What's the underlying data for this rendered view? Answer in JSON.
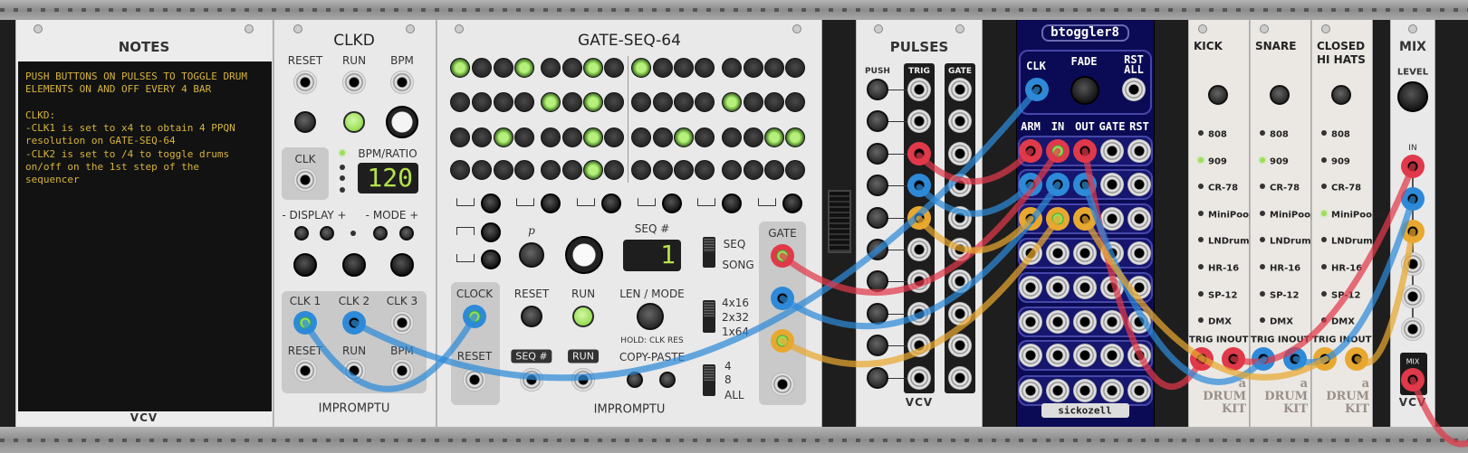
{
  "colors": {
    "cable_red": "#e0394a",
    "cable_blue": "#2e8ad8",
    "cable_yellow": "#e8a830",
    "led_green": "#9be05a",
    "btoggler_panel": "#0b0b55"
  },
  "notes": {
    "title": "NOTES",
    "text": "PUSH BUTTONS ON PULSES TO TOGGLE DRUM\nELEMENTS ON AND OFF EVERY 4 BAR\n\nCLKD:\n-CLK1 is set to x4 to obtain 4 PPQN\nresolution on GATE-SEQ-64\n-CLK2 is set to /4 to toggle drums\non/off on the 1st step of the\nsequencer",
    "brand": "VCV"
  },
  "clkd": {
    "title": "CLKD",
    "reset": "RESET",
    "run": "RUN",
    "bpm": "BPM",
    "clk": "CLK",
    "bpm_ratio": "BPM/RATIO",
    "display_ctl": "- DISPLAY +",
    "mode_ctl": "- MODE +",
    "clk1": "CLK 1",
    "clk2": "CLK 2",
    "clk3": "CLK 3",
    "reset_in": "RESET",
    "run_in": "RUN",
    "bpm_in": "BPM",
    "display": "120",
    "brand": "IMPROMPTU"
  },
  "gate_seq": {
    "title": "GATE-SEQ-64",
    "grid": [
      [
        1,
        0,
        0,
        1,
        0,
        0,
        1,
        0,
        1,
        0,
        0,
        0,
        0,
        0,
        0,
        0
      ],
      [
        0,
        0,
        0,
        0,
        1,
        0,
        1,
        0,
        0,
        0,
        0,
        0,
        1,
        0,
        0,
        0
      ],
      [
        0,
        0,
        1,
        0,
        0,
        0,
        1,
        0,
        0,
        0,
        1,
        0,
        0,
        0,
        1,
        1
      ],
      [
        0,
        0,
        0,
        0,
        0,
        0,
        1,
        0,
        0,
        0,
        0,
        0,
        0,
        0,
        0,
        0
      ]
    ],
    "p": "p",
    "seq_num": "SEQ #",
    "seq_display": "1",
    "seq": "SEQ",
    "song": "SONG",
    "clock": "CLOCK",
    "reset": "RESET",
    "run": "RUN",
    "len_mode": "LEN / MODE",
    "hold": "HOLD: CLK RES",
    "seq_in": "SEQ #",
    "run_in": "RUN",
    "reset_in": "RESET",
    "copy_paste": "COPY-PASTE",
    "len_options": [
      "4x16",
      "2x32",
      "1x64"
    ],
    "copy_options": [
      "4",
      "8",
      "ALL"
    ],
    "gate": "GATE",
    "brand": "IMPROMPTU"
  },
  "pulses": {
    "title": "PULSES",
    "push": "PUSH",
    "trig": "TRIG",
    "gate": "GATE",
    "brand": "VCV"
  },
  "btoggler": {
    "title": "btoggler8",
    "clk": "CLK",
    "fade": "FADE",
    "rst": "RST",
    "all": "ALL",
    "cols": [
      "ARM",
      "IN",
      "OUT",
      "GATE",
      "RST"
    ],
    "brand": "sickozell"
  },
  "drums": {
    "kits": [
      "808",
      "909",
      "CR-78",
      "MiniPoops",
      "LNDrum",
      "HR-16",
      "SP-12",
      "DMX"
    ],
    "trig_in": "TRIG IN",
    "out": "OUT",
    "logo": "a DRUM KIT",
    "modules": [
      {
        "title": "KICK",
        "selected": "909"
      },
      {
        "title": "SNARE",
        "selected": "909"
      },
      {
        "title": "CLOSED\nHI HATS",
        "selected": "MiniPoops"
      }
    ]
  },
  "mix": {
    "title": "MIX",
    "level": "LEVEL",
    "in": "IN",
    "mix": "MIX",
    "brand": "VCV"
  }
}
